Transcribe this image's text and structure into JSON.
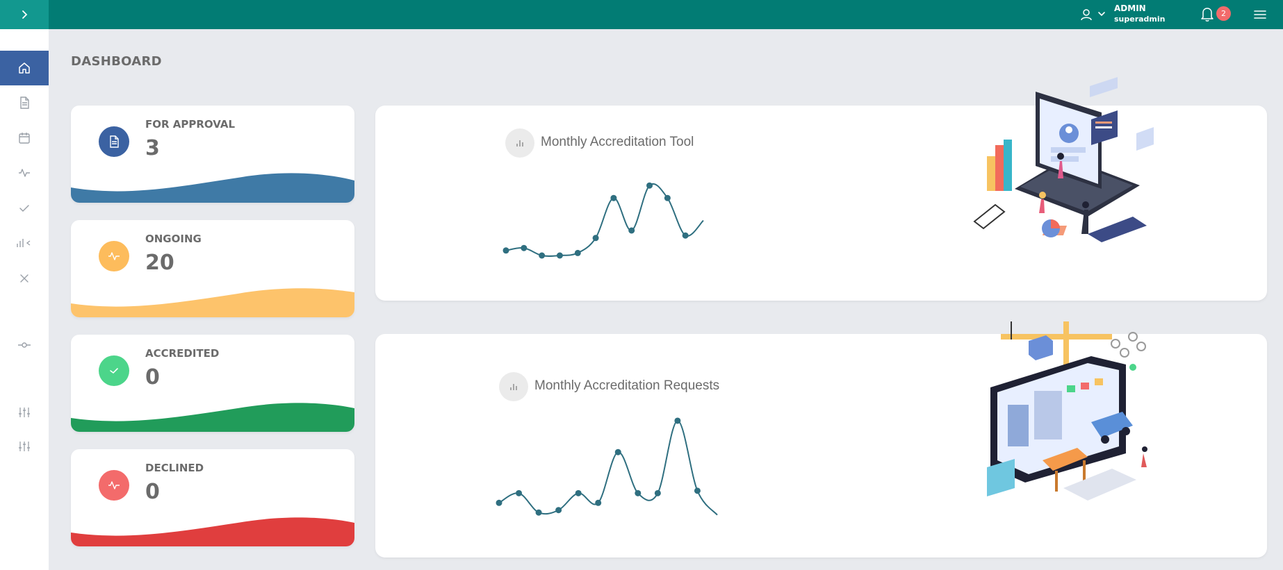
{
  "header": {
    "user": {
      "role": "ADMIN",
      "username": "superadmin"
    },
    "notifications": {
      "count": "2"
    },
    "accent": "#027c74"
  },
  "sidebar": {
    "items": [
      {
        "name": "home",
        "icon": "home-icon",
        "active": true
      },
      {
        "name": "documents",
        "icon": "document-icon"
      },
      {
        "name": "calendar",
        "icon": "calendar-icon"
      },
      {
        "name": "activity",
        "icon": "activity-icon"
      },
      {
        "name": "accredited",
        "icon": "check-icon"
      },
      {
        "name": "reports",
        "icon": "bar-chart-icon"
      },
      {
        "name": "declined",
        "icon": "close-icon"
      },
      {
        "name": "commit",
        "icon": "commit-icon"
      },
      {
        "name": "settings-1",
        "icon": "sliders-icon"
      },
      {
        "name": "settings-2",
        "icon": "sliders-icon"
      }
    ]
  },
  "page": {
    "title": "DASHBOARD"
  },
  "stats": [
    {
      "label": "FOR APPROVAL",
      "value": "3",
      "color": "#3b62a2",
      "wave_color": "#3f7aa6",
      "icon": "document-icon"
    },
    {
      "label": "ONGOING",
      "value": "20",
      "color": "#fdbc5c",
      "wave_color": "#fdc36b",
      "icon": "activity-icon"
    },
    {
      "label": "ACCREDITED",
      "value": "0",
      "color": "#4cd58a",
      "wave_color": "#219c5a",
      "icon": "check-icon"
    },
    {
      "label": "DECLINED",
      "value": "0",
      "color": "#f36b6b",
      "wave_color": "#e03e3e",
      "icon": "activity-icon"
    }
  ],
  "charts": {
    "tool": {
      "title": "Monthly Accreditation Tool"
    },
    "requests": {
      "title": "Monthly Accreditation Requests"
    }
  },
  "chart_data": [
    {
      "type": "line",
      "title": "Monthly Accreditation Tool",
      "x": [
        1,
        2,
        3,
        4,
        5,
        6,
        7,
        8,
        9,
        10,
        11,
        12
      ],
      "values": [
        12,
        13,
        10,
        10,
        11,
        17,
        33,
        20,
        38,
        33,
        18,
        24
      ],
      "color": "#2f6f80",
      "ylim": [
        0,
        40
      ]
    },
    {
      "type": "line",
      "title": "Monthly Accreditation Requests",
      "x": [
        1,
        2,
        3,
        4,
        5,
        6,
        7,
        8,
        9,
        10,
        11,
        12
      ],
      "values": [
        14,
        18,
        10,
        11,
        18,
        14,
        35,
        18,
        18,
        48,
        19,
        9
      ],
      "color": "#2f6f80",
      "ylim": [
        0,
        50
      ]
    }
  ]
}
